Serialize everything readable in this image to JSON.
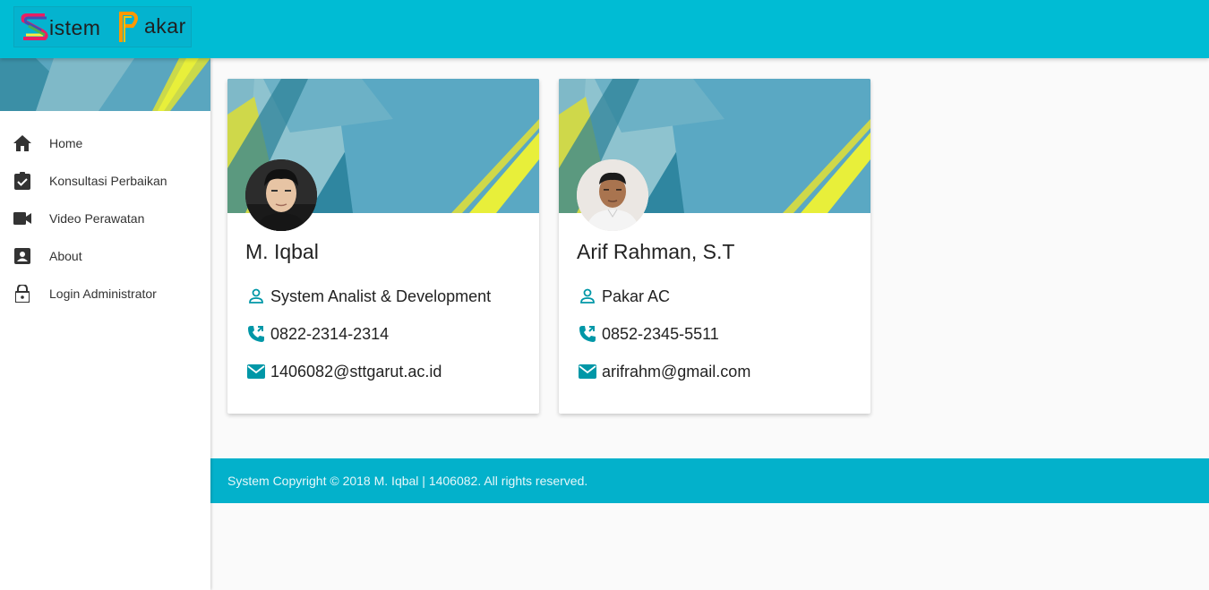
{
  "brand": {
    "word1": "istem",
    "word2": "akar",
    "accent": "#00bcd4"
  },
  "sidebar": {
    "items": [
      {
        "label": "Home",
        "icon": "home-icon"
      },
      {
        "label": "Konsultasi Perbaikan",
        "icon": "clipboard-check-icon"
      },
      {
        "label": "Video Perawatan",
        "icon": "videocam-icon"
      },
      {
        "label": "About",
        "icon": "account-box-icon"
      },
      {
        "label": "Login Administrator",
        "icon": "lock-icon"
      }
    ]
  },
  "cards": [
    {
      "name": "M. Iqbal",
      "role": "System Analist & Development",
      "phone": "0822-2314-2314",
      "email": "1406082@sttgarut.ac.id"
    },
    {
      "name": "Arif Rahman, S.T",
      "role": "Pakar AC",
      "phone": "0852-2345-5511",
      "email": "arifrahm@gmail.com"
    }
  ],
  "footer": {
    "text": "System Copyright © 2018 M. Iqbal | 1406082. All rights reserved."
  }
}
